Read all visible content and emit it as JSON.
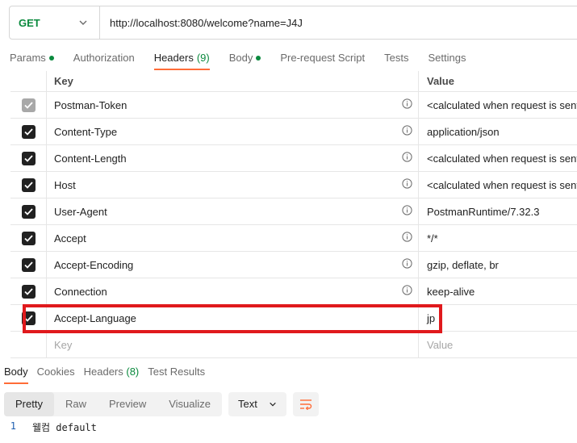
{
  "request": {
    "method": "GET",
    "url": "http://localhost:8080/welcome?name=J4J"
  },
  "tabs": [
    {
      "label": "Params",
      "dot": true
    },
    {
      "label": "Authorization"
    },
    {
      "label": "Headers",
      "count": "(9)",
      "active": true
    },
    {
      "label": "Body",
      "dot": true
    },
    {
      "label": "Pre-request Script"
    },
    {
      "label": "Tests"
    },
    {
      "label": "Settings"
    }
  ],
  "headers_table": {
    "columns": {
      "key": "Key",
      "value": "Value"
    },
    "rows": [
      {
        "key": "Postman-Token",
        "value": "<calculated when request is sent>",
        "checked": true,
        "disabled": true,
        "info": true
      },
      {
        "key": "Content-Type",
        "value": "application/json",
        "checked": true,
        "info": true
      },
      {
        "key": "Content-Length",
        "value": "<calculated when request is sent>",
        "checked": true,
        "info": true
      },
      {
        "key": "Host",
        "value": "<calculated when request is sent>",
        "checked": true,
        "info": true
      },
      {
        "key": "User-Agent",
        "value": "PostmanRuntime/7.32.3",
        "checked": true,
        "info": true
      },
      {
        "key": "Accept",
        "value": "*/*",
        "checked": true,
        "info": true
      },
      {
        "key": "Accept-Encoding",
        "value": "gzip, deflate, br",
        "checked": true,
        "info": true
      },
      {
        "key": "Connection",
        "value": "keep-alive",
        "checked": true,
        "info": true
      },
      {
        "key": "Accept-Language",
        "value": "jp",
        "checked": true,
        "info": false
      }
    ],
    "placeholder": {
      "key": "Key",
      "value": "Value"
    }
  },
  "response": {
    "tabs": [
      {
        "label": "Body",
        "active": true
      },
      {
        "label": "Cookies"
      },
      {
        "label": "Headers",
        "count": "(8)"
      },
      {
        "label": "Test Results"
      }
    ],
    "views": [
      "Pretty",
      "Raw",
      "Preview",
      "Visualize"
    ],
    "active_view": "Pretty",
    "format": "Text",
    "lines": [
      {
        "num": "1",
        "text": "웰컴 default"
      }
    ]
  },
  "colors": {
    "accent": "#ff6c37",
    "method": "#0b8a3e",
    "highlight": "#e0191c"
  }
}
